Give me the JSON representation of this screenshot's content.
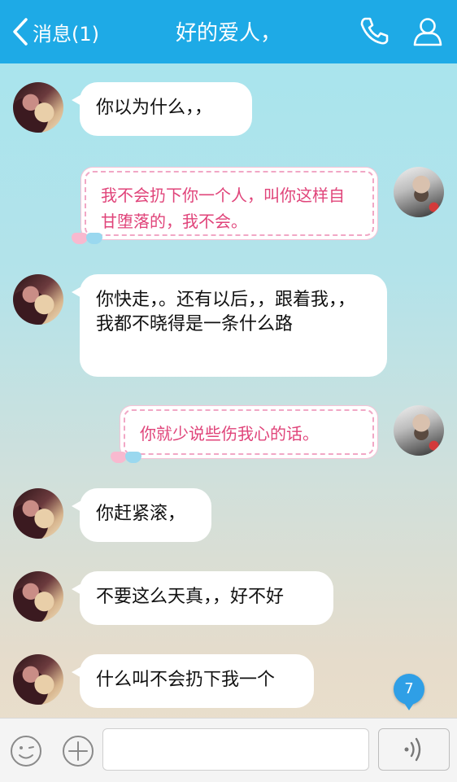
{
  "header": {
    "back_label": "消息(1)",
    "title": "好的爱人，",
    "phone_icon": "phone-icon",
    "contact_icon": "contact-profile-icon"
  },
  "messages": [
    {
      "side": "left",
      "text": "你以为什么，，"
    },
    {
      "side": "right",
      "style": "fancy",
      "text": "我不会扔下你一个人，叫你这样自甘堕落的，我不会。"
    },
    {
      "side": "left",
      "text": "你快走，。还有以后，，跟着我，，我都不晓得是一条什么路"
    },
    {
      "side": "right",
      "style": "fancy",
      "text": "你就少说些伤我心的话。"
    },
    {
      "side": "left",
      "text": "你赶紧滚，"
    },
    {
      "side": "left",
      "text": "不要这么天真，，好不好"
    },
    {
      "side": "left",
      "text": "什么叫不会扔下我一个"
    }
  ],
  "unread_badge": "7",
  "input": {
    "value": "",
    "placeholder": "",
    "emoji_icon": "emoji-icon",
    "plus_icon": "plus-icon",
    "voice_icon": "voice-icon"
  },
  "colors": {
    "header": "#1eaae6",
    "bubble": "#ffffff",
    "fancy_text": "#e0447a",
    "badge": "#2f9fe6"
  }
}
